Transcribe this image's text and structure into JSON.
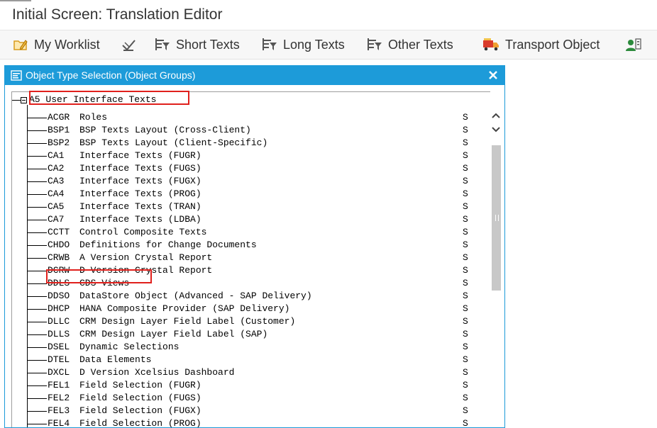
{
  "window": {
    "title": "Initial Screen: Translation Editor"
  },
  "toolbar": {
    "buttons": [
      {
        "label": "My Worklist",
        "icon": "folder-pencil-icon"
      },
      {
        "label": "",
        "icon": "stamp-check-icon"
      },
      {
        "label": "Short Texts",
        "icon": "filter-list-icon"
      },
      {
        "label": "Long Texts",
        "icon": "filter-list-icon"
      },
      {
        "label": "Other Texts",
        "icon": "filter-list-icon"
      },
      {
        "label": "Transport Object",
        "icon": "truck-icon"
      },
      {
        "label": "",
        "icon": "user-settings-icon"
      }
    ]
  },
  "dialog": {
    "title": "Object Type Selection (Object Groups)",
    "icon": "selection-list-icon",
    "close_icon": "close-icon",
    "tree": {
      "root": {
        "code": "A5",
        "label": "User Interface Texts"
      },
      "items": [
        {
          "code": "ACGR",
          "label": "Roles",
          "status": "S"
        },
        {
          "code": "BSP1",
          "label": "BSP Texts Layout (Cross-Client)",
          "status": "S"
        },
        {
          "code": "BSP2",
          "label": "BSP Texts Layout (Client-Specific)",
          "status": "S"
        },
        {
          "code": "CA1",
          "label": "Interface Texts (FUGR)",
          "status": "S"
        },
        {
          "code": "CA2",
          "label": "Interface Texts (FUGS)",
          "status": "S"
        },
        {
          "code": "CA3",
          "label": "Interface Texts (FUGX)",
          "status": "S"
        },
        {
          "code": "CA4",
          "label": "Interface Texts (PROG)",
          "status": "S"
        },
        {
          "code": "CA5",
          "label": "Interface Texts (TRAN)",
          "status": "S"
        },
        {
          "code": "CA7",
          "label": "Interface Texts (LDBA)",
          "status": "S"
        },
        {
          "code": "CCTT",
          "label": "Control Composite Texts",
          "status": "S"
        },
        {
          "code": "CHDO",
          "label": "Definitions for Change Documents",
          "status": "S"
        },
        {
          "code": "CRWB",
          "label": "A Version Crystal Report",
          "status": "S"
        },
        {
          "code": "DCRW",
          "label": "D Version Crystal Report",
          "status": "S"
        },
        {
          "code": "DDLS",
          "label": "CDS Views",
          "status": "S"
        },
        {
          "code": "DDSO",
          "label": "DataStore Object (Advanced - SAP Delivery)",
          "status": "S"
        },
        {
          "code": "DHCP",
          "label": "HANA Composite Provider (SAP Delivery)",
          "status": "S"
        },
        {
          "code": "DLLC",
          "label": "CRM Design Layer Field Label (Customer)",
          "status": "S"
        },
        {
          "code": "DLLS",
          "label": "CRM Design Layer Field Label (SAP)",
          "status": "S"
        },
        {
          "code": "DSEL",
          "label": "Dynamic Selections",
          "status": "S"
        },
        {
          "code": "DTEL",
          "label": "Data Elements",
          "status": "S"
        },
        {
          "code": "DXCL",
          "label": "D Version Xcelsius Dashboard",
          "status": "S"
        },
        {
          "code": "FEL1",
          "label": "Field Selection (FUGR)",
          "status": "S"
        },
        {
          "code": "FEL2",
          "label": "Field Selection (FUGS)",
          "status": "S"
        },
        {
          "code": "FEL3",
          "label": "Field Selection (FUGX)",
          "status": "S"
        },
        {
          "code": "FEL4",
          "label": "Field Selection (PROG)",
          "status": "S"
        }
      ]
    }
  },
  "colors": {
    "dialog_header": "#1d9bd9",
    "highlight": "#e0201c",
    "scroll_thumb": "#c8c8c8"
  }
}
